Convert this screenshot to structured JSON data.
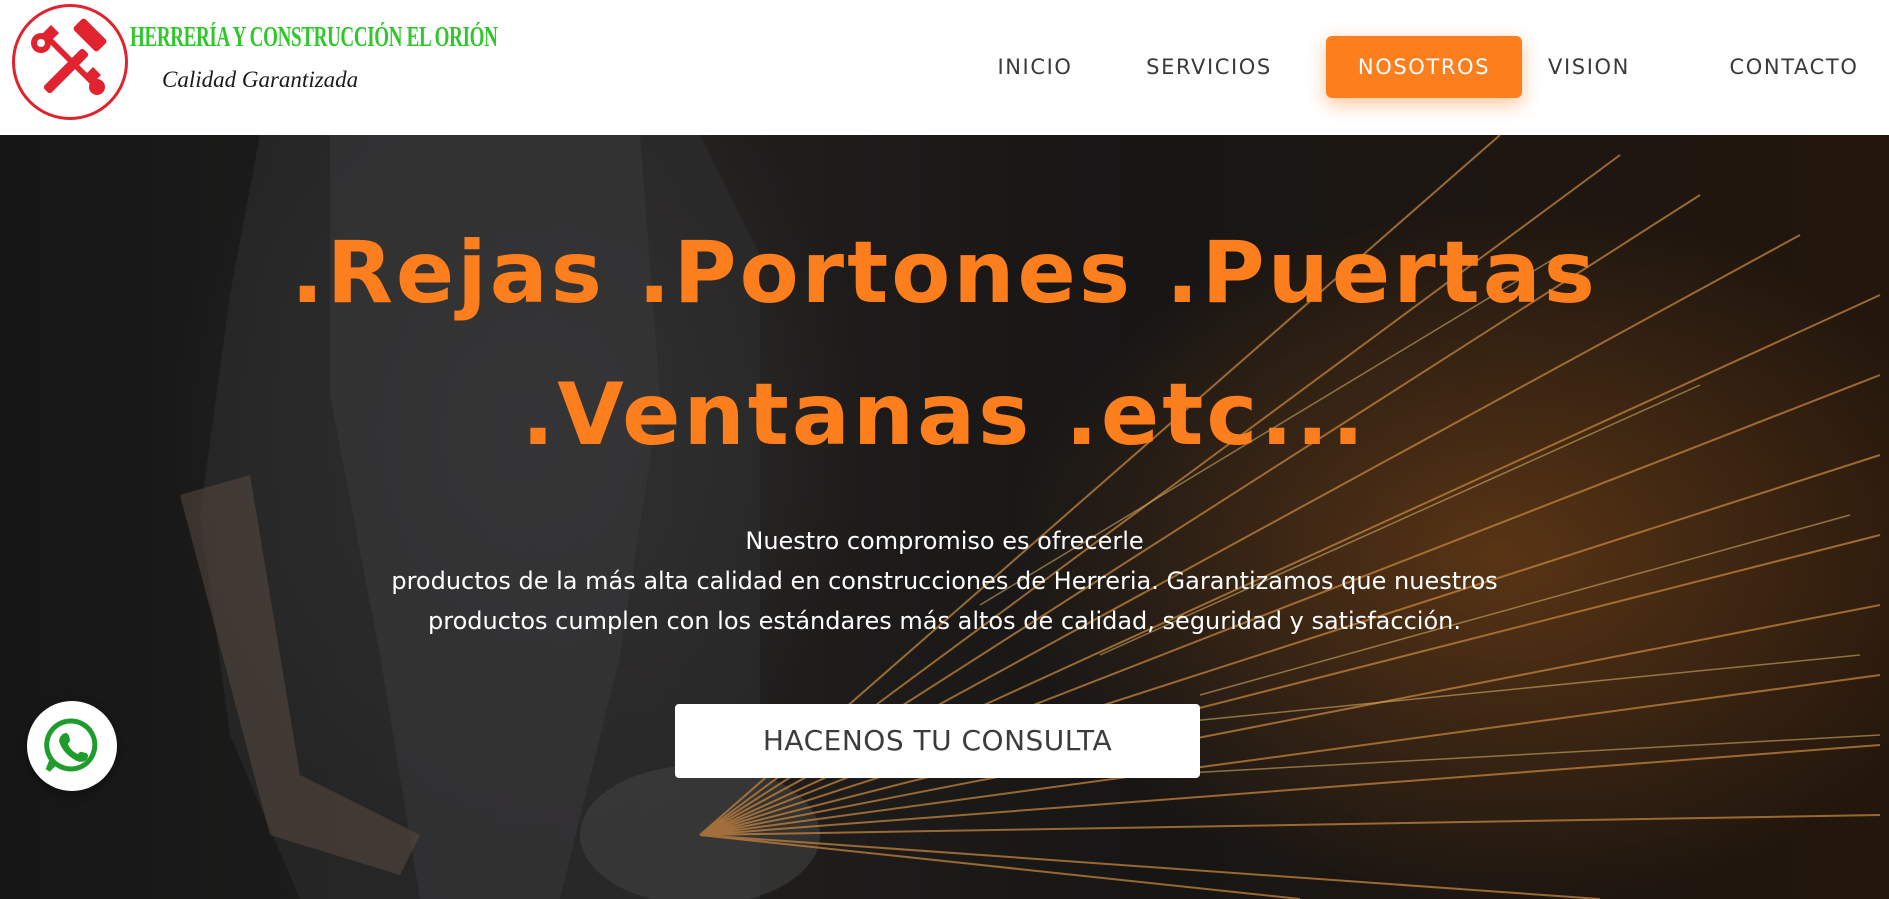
{
  "brand": {
    "name": "HERRERÍA Y CONSTRUCCIÓN EL ORIÓN",
    "slogan": "Calidad Garantizada",
    "icon": "crossed-tools-icon",
    "colors": {
      "name": "#2fc82b",
      "ring": "#e0232e"
    }
  },
  "nav": {
    "items": [
      {
        "label": "INICIO",
        "active": false
      },
      {
        "label": "SERVICIOS",
        "active": false
      },
      {
        "label": "NOSOTROS",
        "active": true
      },
      {
        "label": "VISION",
        "active": false
      },
      {
        "label": "CONTACTO",
        "active": false
      }
    ]
  },
  "hero": {
    "title_line1": ".Rejas .Portones .Puertas",
    "title_line2": ".Ventanas .etc...",
    "text_line1": "Nuestro compromiso es ofrecerle",
    "text_line2": "productos de la más alta calidad en construcciones de Herreria. Garantizamos que nuestros",
    "text_line3": "productos cumplen con los estándares más altos de calidad, seguridad y satisfacción.",
    "cta_label": "HACENOS TU CONSULTA"
  },
  "whatsapp": {
    "icon": "whatsapp-icon",
    "color": "#1f9c2b"
  },
  "colors": {
    "accent": "#fd7e1d",
    "text_dark": "#3a3a3a",
    "white": "#ffffff"
  }
}
